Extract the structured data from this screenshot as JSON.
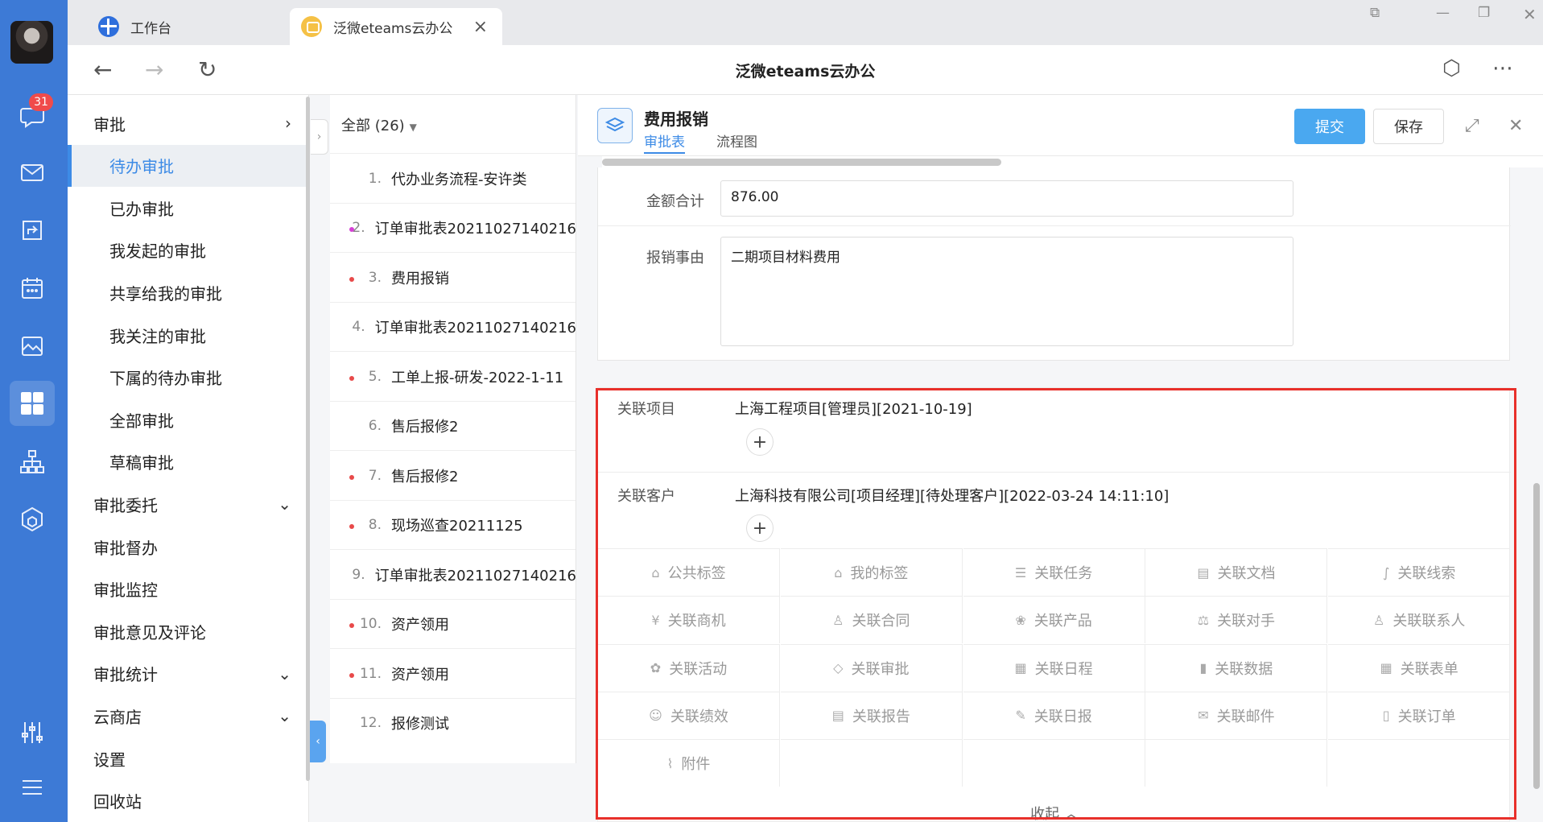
{
  "rail": {
    "badge": "31",
    "icons": [
      "chat-icon",
      "mail-icon",
      "share-icon",
      "calendar-icon",
      "gallery-icon",
      "apps-icon",
      "org-chart-icon",
      "cube-icon",
      "sliders-icon",
      "hamburger-menu-icon"
    ]
  },
  "tabs": [
    {
      "label": "工作台"
    },
    {
      "label": "泛微eteams云办公"
    }
  ],
  "navbar": {
    "title": "泛微eteams云办公"
  },
  "menu": {
    "items": [
      {
        "label": "审批",
        "level": 1,
        "arrow": "›"
      },
      {
        "label": "待办审批",
        "level": 2,
        "active": true
      },
      {
        "label": "已办审批",
        "level": 2
      },
      {
        "label": "我发起的审批",
        "level": 2
      },
      {
        "label": "共享给我的审批",
        "level": 2
      },
      {
        "label": "我关注的审批",
        "level": 2
      },
      {
        "label": "下属的待办审批",
        "level": 2
      },
      {
        "label": "全部审批",
        "level": 2
      },
      {
        "label": "草稿审批",
        "level": 2
      },
      {
        "label": "审批委托",
        "level": 1,
        "arrow": "⌄"
      },
      {
        "label": "审批督办",
        "level": 1
      },
      {
        "label": "审批监控",
        "level": 1
      },
      {
        "label": "审批意见及评论",
        "level": 1
      },
      {
        "label": "审批统计",
        "level": 1,
        "arrow": "⌄"
      },
      {
        "label": "云商店",
        "level": 1,
        "arrow": "⌄"
      },
      {
        "label": "设置",
        "level": 1
      },
      {
        "label": "回收站",
        "level": 1
      }
    ]
  },
  "list": {
    "filter": "全部 (26)",
    "rows": [
      {
        "num": "1.",
        "title": "代办业务流程-安许类",
        "dot": ""
      },
      {
        "num": "2.",
        "title": "订单审批表20211027140216",
        "dot": "pink"
      },
      {
        "num": "3.",
        "title": "费用报销",
        "dot": "red"
      },
      {
        "num": "4.",
        "title": "订单审批表20211027140216",
        "dot": ""
      },
      {
        "num": "5.",
        "title": "工单上报-研发-2022-1-11",
        "dot": "red"
      },
      {
        "num": "6.",
        "title": "售后报修2",
        "dot": ""
      },
      {
        "num": "7.",
        "title": "售后报修2",
        "dot": "red"
      },
      {
        "num": "8.",
        "title": "现场巡查20211125",
        "dot": "red"
      },
      {
        "num": "9.",
        "title": "订单审批表20211027140216",
        "dot": ""
      },
      {
        "num": "10.",
        "title": "资产领用",
        "dot": "red"
      },
      {
        "num": "11.",
        "title": "资产领用",
        "dot": "red"
      },
      {
        "num": "12.",
        "title": "报修测试",
        "dot": ""
      }
    ]
  },
  "detail": {
    "title": "费用报销",
    "tabs": [
      "审批表",
      "流程图"
    ],
    "submit_label": "提交",
    "save_label": "保存",
    "amount_label": "金额合计",
    "amount_value": "876.00",
    "reason_label": "报销事由",
    "reason_value": "二期项目材料费用",
    "related_project_label": "关联项目",
    "related_project_value": "上海工程项目[管理员][2021-10-19]",
    "related_customer_label": "关联客户",
    "related_customer_value": "上海科技有限公司[项目经理][待处理客户][2022-03-24 14:11:10]",
    "related_grid": [
      {
        "label": "公共标签",
        "icon": "tag-icon"
      },
      {
        "label": "我的标签",
        "icon": "tag-icon"
      },
      {
        "label": "关联任务",
        "icon": "list-icon"
      },
      {
        "label": "关联文档",
        "icon": "document-icon"
      },
      {
        "label": "关联线索",
        "icon": "clue-icon"
      },
      {
        "label": "关联商机",
        "icon": "yen-icon"
      },
      {
        "label": "关联合同",
        "icon": "contract-icon"
      },
      {
        "label": "关联产品",
        "icon": "product-icon"
      },
      {
        "label": "关联对手",
        "icon": "rival-icon"
      },
      {
        "label": "关联联系人",
        "icon": "contact-icon"
      },
      {
        "label": "关联活动",
        "icon": "activity-icon"
      },
      {
        "label": "关联审批",
        "icon": "layers-icon"
      },
      {
        "label": "关联日程",
        "icon": "calendar-icon"
      },
      {
        "label": "关联数据",
        "icon": "bar-chart-icon"
      },
      {
        "label": "关联表单",
        "icon": "table-icon"
      },
      {
        "label": "关联绩效",
        "icon": "performance-icon"
      },
      {
        "label": "关联报告",
        "icon": "report-icon"
      },
      {
        "label": "关联日报",
        "icon": "edit-icon"
      },
      {
        "label": "关联邮件",
        "icon": "mail-icon"
      },
      {
        "label": "关联订单",
        "icon": "order-icon"
      },
      {
        "label": "附件",
        "icon": "paperclip-icon"
      }
    ],
    "collapse_label": "收起"
  }
}
